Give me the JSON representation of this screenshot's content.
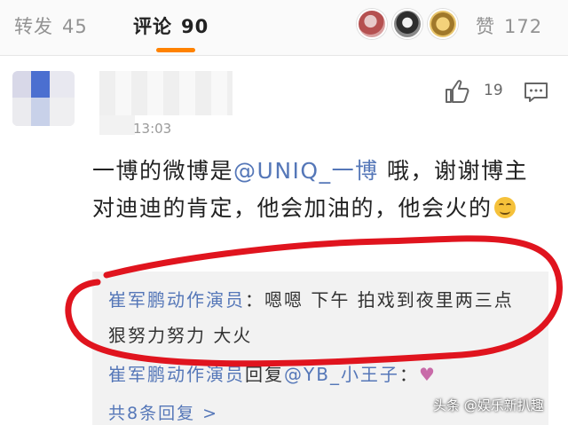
{
  "tabs": [
    {
      "label": "转发",
      "count": "45"
    },
    {
      "label": "评论",
      "count": "90"
    },
    {
      "label": "赞",
      "count": "172"
    }
  ],
  "comment": {
    "time": "13:03",
    "like_count": "19",
    "text_before_mention": "一博的微博是",
    "mention": "@UNIQ_一博",
    "text_after_mention": " 哦，谢谢博主对迪迪的肯定，他会加油的，他会火的"
  },
  "replies": [
    {
      "author": "崔军鹏动作演员",
      "text": "：嗯嗯  下午 拍戏到夜里两三点 狠努力努力  大火"
    },
    {
      "author": "崔军鹏动作演员",
      "text": "回复",
      "mention": "@YB_小王子",
      "suffix": "："
    }
  ],
  "more_replies": "共8条回复 >",
  "watermark": "头条 @娱乐新扒趣",
  "colors": {
    "accent": "#ff8200",
    "link": "#5577b8",
    "annotation": "#e0141e"
  }
}
